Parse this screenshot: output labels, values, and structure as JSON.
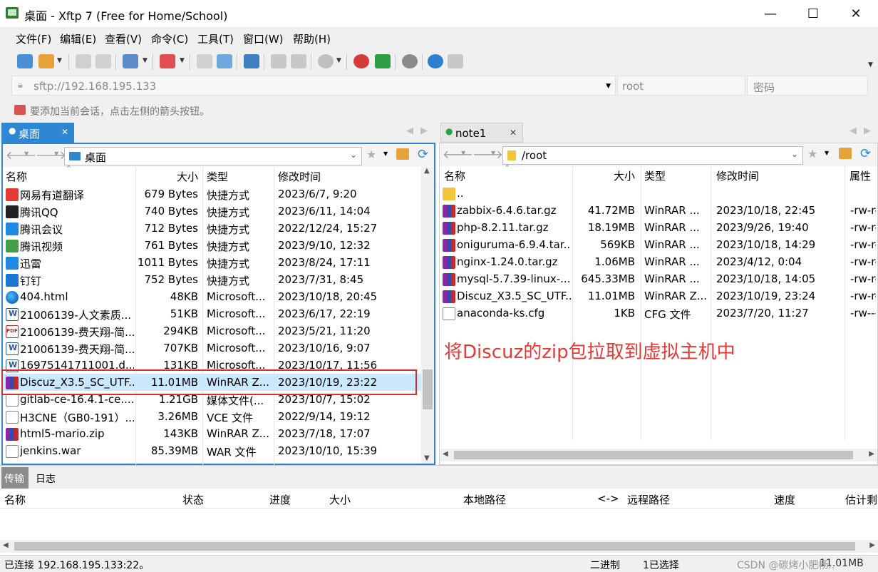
{
  "window": {
    "title": "桌面 - Xftp 7 (Free for Home/School)",
    "min": "—",
    "max": "☐",
    "close": "✕"
  },
  "menu": [
    "文件(F)",
    "编辑(E)",
    "查看(V)",
    "命令(C)",
    "工具(T)",
    "窗口(W)",
    "帮助(H)"
  ],
  "address": {
    "value": "sftp://192.168.195.133",
    "user_placeholder": "root",
    "pass_placeholder": "密码"
  },
  "hint": "要添加当前会话，点击左侧的箭头按钮。",
  "left": {
    "tab": "桌面",
    "path": "桌面",
    "headers": [
      "名称",
      "大小",
      "类型",
      "修改时间"
    ],
    "rows": [
      {
        "icon": "youdao-icon",
        "name": "网易有道翻译",
        "size": "679 Bytes",
        "type": "快捷方式",
        "time": "2023/6/7, 9:20"
      },
      {
        "icon": "qq-icon",
        "name": "腾讯QQ",
        "size": "740 Bytes",
        "type": "快捷方式",
        "time": "2023/6/11, 14:04"
      },
      {
        "icon": "tencent-meeting-icon",
        "name": "腾讯会议",
        "size": "712 Bytes",
        "type": "快捷方式",
        "time": "2022/12/24, 15:27"
      },
      {
        "icon": "tencent-video-icon",
        "name": "腾讯视频",
        "size": "761 Bytes",
        "type": "快捷方式",
        "time": "2023/9/10, 12:32"
      },
      {
        "icon": "xunlei-icon",
        "name": "迅雷",
        "size": "1011 Bytes",
        "type": "快捷方式",
        "time": "2023/8/24, 17:11"
      },
      {
        "icon": "dingtalk-icon",
        "name": "钉钉",
        "size": "752 Bytes",
        "type": "快捷方式",
        "time": "2023/7/31, 8:45"
      },
      {
        "icon": "edge-icon",
        "name": "404.html",
        "size": "48KB",
        "type": "Microsoft...",
        "time": "2023/10/18, 20:45"
      },
      {
        "icon": "word-icon",
        "name": "21006139-人文素质...",
        "size": "51KB",
        "type": "Microsoft...",
        "time": "2023/6/17, 22:19"
      },
      {
        "icon": "pdf-icon",
        "name": "21006139-费天翔-简...",
        "size": "294KB",
        "type": "Microsoft...",
        "time": "2023/5/21, 11:20"
      },
      {
        "icon": "word-icon",
        "name": "21006139-费天翔-简...",
        "size": "707KB",
        "type": "Microsoft...",
        "time": "2023/10/16, 9:07"
      },
      {
        "icon": "word-icon",
        "name": "16975141711001.d...",
        "size": "131KB",
        "type": "Microsoft...",
        "time": "2023/10/17, 11:56"
      },
      {
        "icon": "rar-icon",
        "name": "Discuz_X3.5_SC_UTF...",
        "size": "11.01MB",
        "type": "WinRAR Z...",
        "time": "2023/10/19, 23:22"
      },
      {
        "icon": "file-icon",
        "name": "gitlab-ce-16.4.1-ce....",
        "size": "1.21GB",
        "type": "媒体文件(...",
        "time": "2023/10/7, 15:02"
      },
      {
        "icon": "file-icon",
        "name": "H3CNE（GB0-191）...",
        "size": "3.26MB",
        "type": "VCE 文件",
        "time": "2022/9/14, 19:12"
      },
      {
        "icon": "rar-icon",
        "name": "html5-mario.zip",
        "size": "143KB",
        "type": "WinRAR Z...",
        "time": "2023/7/18, 17:07"
      },
      {
        "icon": "file-icon",
        "name": "jenkins.war",
        "size": "85.39MB",
        "type": "WAR 文件",
        "time": "2023/10/10, 15:39"
      }
    ]
  },
  "right": {
    "tab": "note1",
    "path": "/root",
    "headers": [
      "名称",
      "大小",
      "类型",
      "修改时间",
      "属性"
    ],
    "rows": [
      {
        "icon": "folder-icon",
        "name": "..",
        "size": "",
        "type": "",
        "time": "",
        "attr": ""
      },
      {
        "icon": "rar-icon",
        "name": "zabbix-6.4.6.tar.gz",
        "size": "41.72MB",
        "type": "WinRAR ...",
        "time": "2023/10/18, 22:45",
        "attr": "-rw-r-"
      },
      {
        "icon": "rar-icon",
        "name": "php-8.2.11.tar.gz",
        "size": "18.19MB",
        "type": "WinRAR ...",
        "time": "2023/9/26, 19:40",
        "attr": "-rw-r-"
      },
      {
        "icon": "rar-icon",
        "name": "oniguruma-6.9.4.tar...",
        "size": "569KB",
        "type": "WinRAR ...",
        "time": "2023/10/18, 14:29",
        "attr": "-rw-r-"
      },
      {
        "icon": "rar-icon",
        "name": "nginx-1.24.0.tar.gz",
        "size": "1.06MB",
        "type": "WinRAR ...",
        "time": "2023/4/12, 0:04",
        "attr": "-rw-r-"
      },
      {
        "icon": "rar-icon",
        "name": "mysql-5.7.39-linux-...",
        "size": "645.33MB",
        "type": "WinRAR ...",
        "time": "2023/10/18, 14:05",
        "attr": "-rw-r-"
      },
      {
        "icon": "rar-icon",
        "name": "Discuz_X3.5_SC_UTF...",
        "size": "11.01MB",
        "type": "WinRAR Z...",
        "time": "2023/10/19, 23:24",
        "attr": "-rw-r-"
      },
      {
        "icon": "file-icon",
        "name": "anaconda-ks.cfg",
        "size": "1KB",
        "type": "CFG 文件",
        "time": "2023/7/20, 11:27",
        "attr": "-rw---"
      }
    ],
    "annotation": "将Discuz的zip包拉取到虚拟主机中"
  },
  "bottom": {
    "tabs": [
      "传输",
      "日志"
    ],
    "headers": [
      "名称",
      "状态",
      "进度",
      "大小",
      "本地路径",
      "<->",
      "远程路径",
      "速度",
      "估计剩"
    ]
  },
  "status": {
    "connection": "已连接 192.168.195.133:22。",
    "mode": "二进制",
    "selection": "1已选择",
    "size": "11.01MB",
    "watermark": "CSDN @碳烤小肥杨.."
  },
  "colors": {
    "accent": "#2f86d3",
    "annotation": "#e53935",
    "selected": "#cce8ff"
  }
}
